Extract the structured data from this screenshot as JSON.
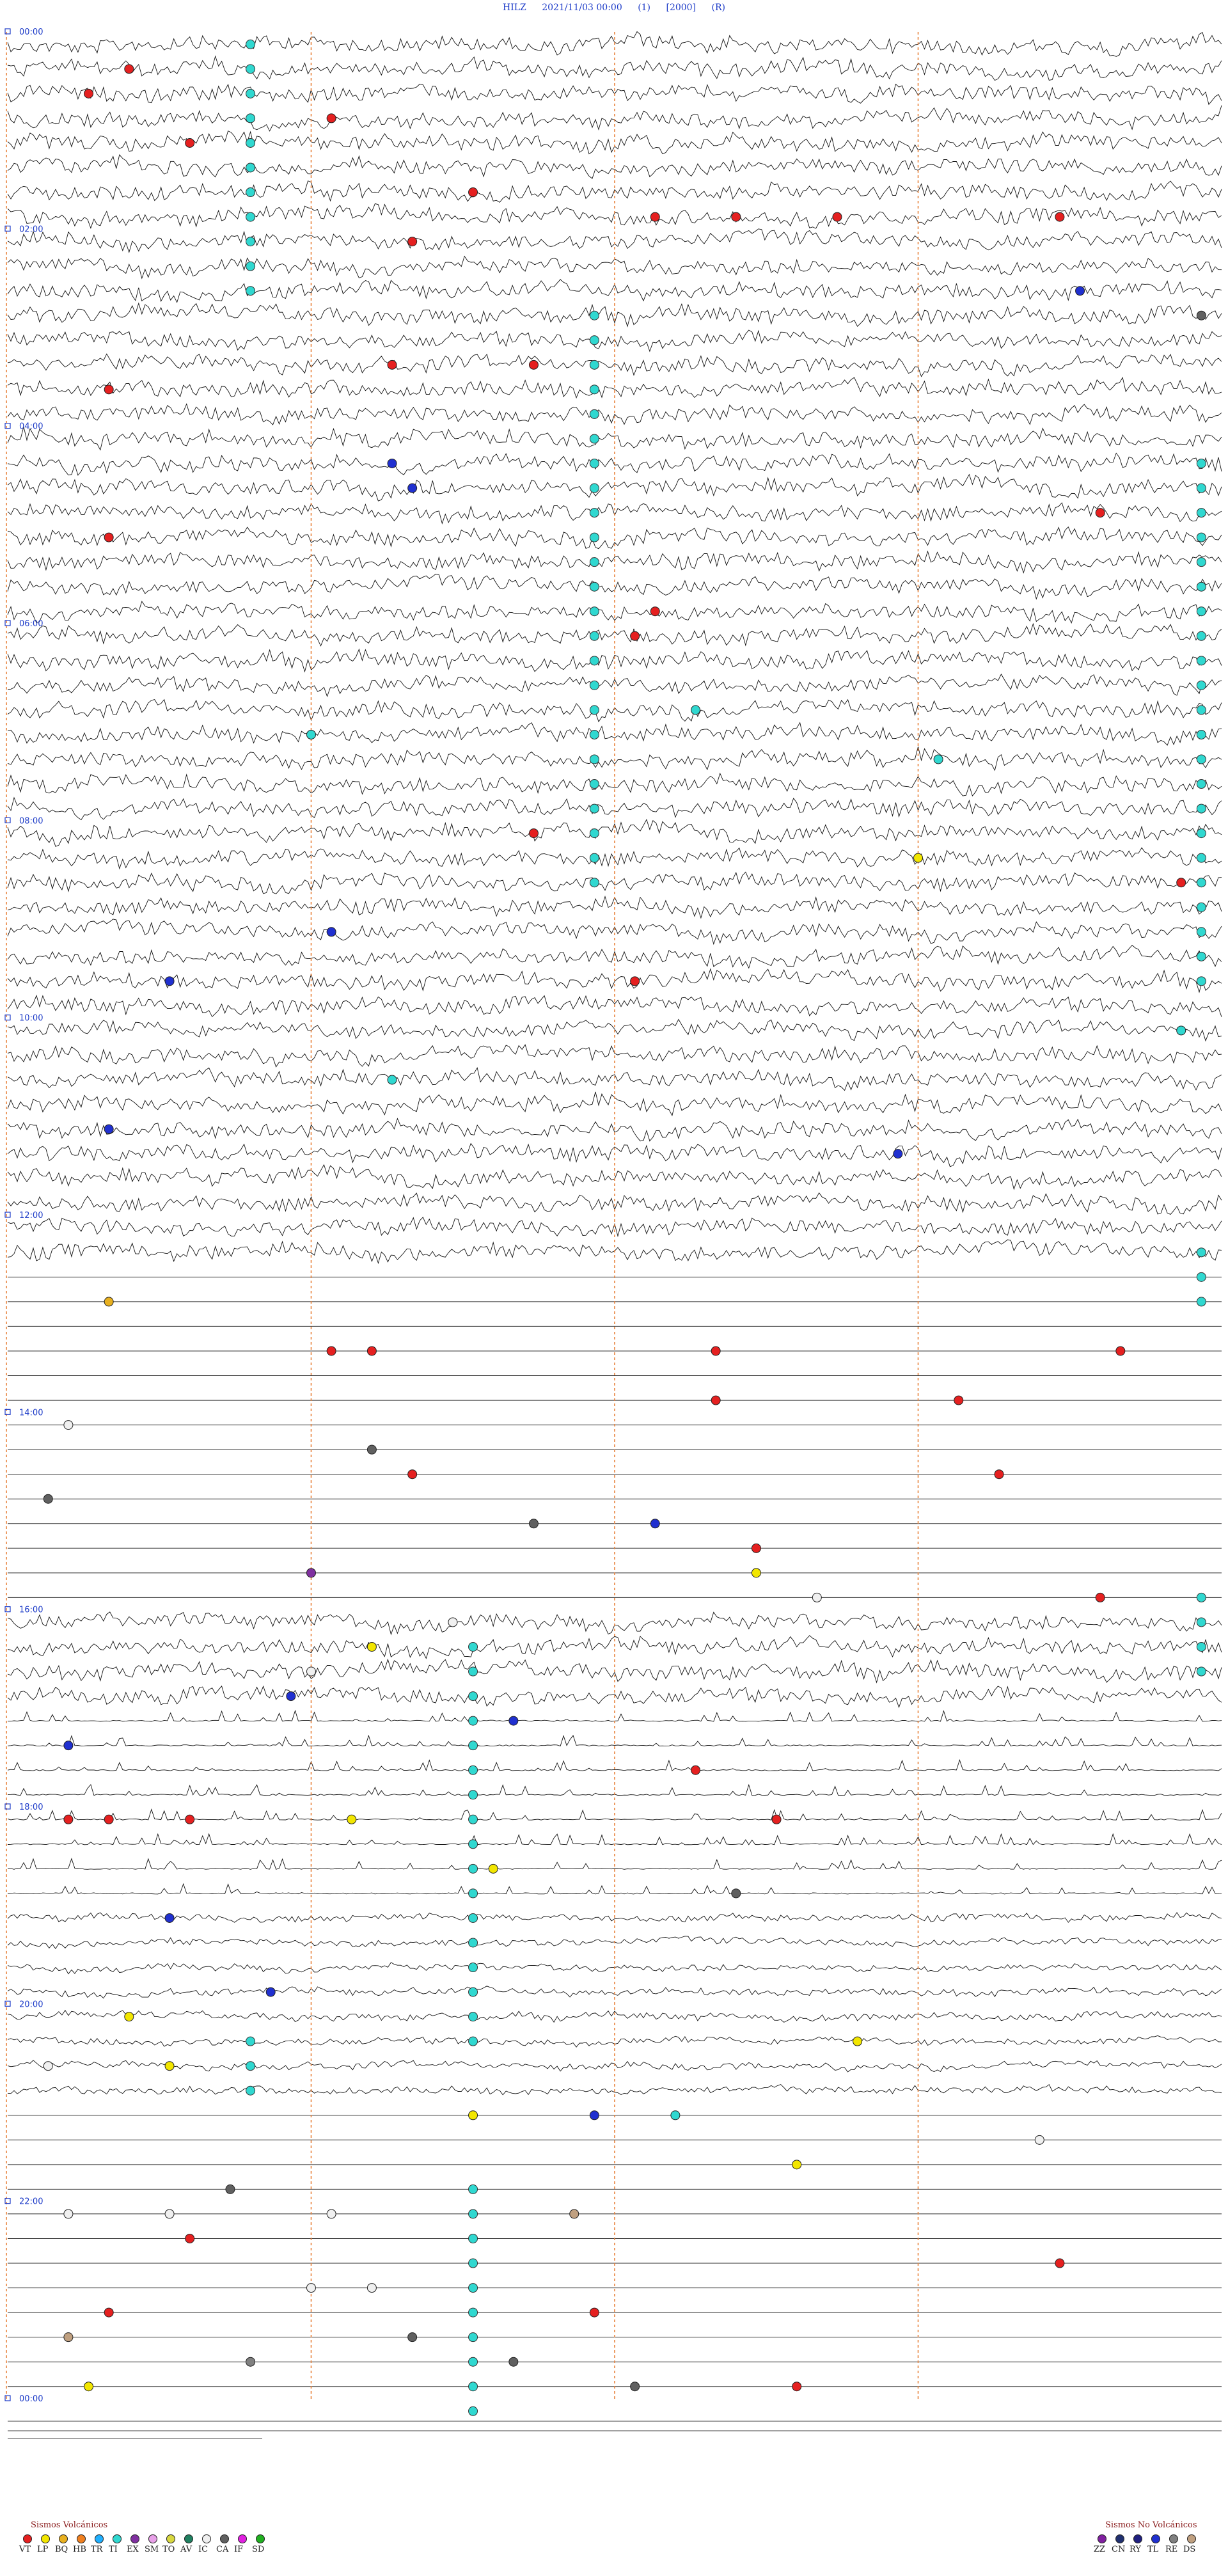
{
  "header": {
    "station": "HILZ",
    "datetime": "2021/11/03 00:00",
    "flag1": "(1)",
    "scale": "[2000]",
    "flag2": "(R)"
  },
  "chart_data": {
    "type": "helicorder",
    "title": "HILZ  2021/11/03 00:00  (1)  [2000]  (R)",
    "hour_labels": [
      {
        "hour": 0,
        "label": "00:00"
      },
      {
        "hour": 2,
        "label": "02:00"
      },
      {
        "hour": 4,
        "label": "04:00"
      },
      {
        "hour": 6,
        "label": "06:00"
      },
      {
        "hour": 8,
        "label": "08:00"
      },
      {
        "hour": 10,
        "label": "10:00"
      },
      {
        "hour": 12,
        "label": "12:00"
      },
      {
        "hour": 14,
        "label": "14:00"
      },
      {
        "hour": 16,
        "label": "16:00"
      },
      {
        "hour": 18,
        "label": "18:00"
      },
      {
        "hour": 20,
        "label": "20:00"
      },
      {
        "hour": 22,
        "label": "22:00"
      },
      {
        "hour": 24,
        "label": "00:00"
      }
    ],
    "minute_markers": [
      15,
      30,
      45
    ],
    "trace_minutes": 15,
    "total_hours": 24,
    "segments": [
      {
        "from_hour": 0,
        "to_hour": 12.5,
        "amplitude": "high"
      },
      {
        "from_hour": 12.5,
        "to_hour": 16,
        "amplitude": "flat"
      },
      {
        "from_hour": 16,
        "to_hour": 17,
        "amplitude": "high"
      },
      {
        "from_hour": 17,
        "to_hour": 19,
        "amplitude": "spiky"
      },
      {
        "from_hour": 19,
        "to_hour": 21,
        "amplitude": "medium"
      },
      {
        "from_hour": 21,
        "to_hour": 24,
        "amplitude": "flat"
      }
    ],
    "events": [
      {
        "hour": 0.25,
        "minute": 6,
        "type": "VT"
      },
      {
        "hour": 0.5,
        "minute": 4,
        "type": "VT"
      },
      {
        "hour": 0.75,
        "minute": 16,
        "type": "VT"
      },
      {
        "hour": 1.0,
        "minute": 9,
        "type": "VT"
      },
      {
        "hour": 1.5,
        "minute": 23,
        "type": "VT"
      },
      {
        "hour": 1.75,
        "minute": 32,
        "type": "VT"
      },
      {
        "hour": 1.75,
        "minute": 36,
        "type": "VT"
      },
      {
        "hour": 1.75,
        "minute": 41,
        "type": "VT"
      },
      {
        "hour": 1.75,
        "minute": 52,
        "type": "VT"
      },
      {
        "hour": 2.0,
        "minute": 20,
        "type": "VT"
      },
      {
        "hour": 2.5,
        "minute": 53,
        "type": "TL"
      },
      {
        "hour": 2.75,
        "minute": 59,
        "type": "CA"
      },
      {
        "hour": 3.25,
        "minute": 19,
        "type": "VT"
      },
      {
        "hour": 3.25,
        "minute": 26,
        "type": "VT"
      },
      {
        "hour": 3.5,
        "minute": 5,
        "type": "VT"
      },
      {
        "hour": 4.25,
        "minute": 19,
        "type": "TL"
      },
      {
        "hour": 4.5,
        "minute": 20,
        "type": "TL"
      },
      {
        "hour": 4.75,
        "minute": 54,
        "type": "VT"
      },
      {
        "hour": 5.0,
        "minute": 5,
        "type": "VT"
      },
      {
        "hour": 5.75,
        "minute": 32,
        "type": "VT"
      },
      {
        "hour": 6.0,
        "minute": 31,
        "type": "VT"
      },
      {
        "hour": 6.75,
        "minute": 34,
        "type": "TI"
      },
      {
        "hour": 7.0,
        "minute": 15,
        "type": "TI"
      },
      {
        "hour": 7.25,
        "minute": 46,
        "type": "TI"
      },
      {
        "hour": 8.0,
        "minute": 26,
        "type": "VT"
      },
      {
        "hour": 8.25,
        "minute": 45,
        "type": "LP"
      },
      {
        "hour": 8.5,
        "minute": 58,
        "type": "VT"
      },
      {
        "hour": 9.0,
        "minute": 16,
        "type": "TL"
      },
      {
        "hour": 9.5,
        "minute": 8,
        "type": "TL"
      },
      {
        "hour": 9.5,
        "minute": 31,
        "type": "VT"
      },
      {
        "hour": 10.0,
        "minute": 58,
        "type": "TI"
      },
      {
        "hour": 10.5,
        "minute": 19,
        "type": "TI"
      },
      {
        "hour": 11.0,
        "minute": 5,
        "type": "TL"
      },
      {
        "hour": 11.25,
        "minute": 44,
        "type": "TL"
      },
      {
        "hour": 12.75,
        "minute": 5,
        "type": "BQ"
      },
      {
        "hour": 13.25,
        "minute": 16,
        "type": "VT"
      },
      {
        "hour": 13.25,
        "minute": 18,
        "type": "VT"
      },
      {
        "hour": 13.25,
        "minute": 35,
        "type": "VT"
      },
      {
        "hour": 13.25,
        "minute": 55,
        "type": "VT"
      },
      {
        "hour": 13.75,
        "minute": 35,
        "type": "VT"
      },
      {
        "hour": 13.75,
        "minute": 47,
        "type": "VT"
      },
      {
        "hour": 14.0,
        "minute": 3,
        "type": "IC"
      },
      {
        "hour": 14.25,
        "minute": 18,
        "type": "CA"
      },
      {
        "hour": 14.5,
        "minute": 20,
        "type": "VT"
      },
      {
        "hour": 14.5,
        "minute": 49,
        "type": "VT"
      },
      {
        "hour": 14.75,
        "minute": 2,
        "type": "CA"
      },
      {
        "hour": 15.0,
        "minute": 26,
        "type": "CA"
      },
      {
        "hour": 15.0,
        "minute": 32,
        "type": "TL"
      },
      {
        "hour": 15.25,
        "minute": 37,
        "type": "VT"
      },
      {
        "hour": 15.5,
        "minute": 15,
        "type": "EX"
      },
      {
        "hour": 15.5,
        "minute": 37,
        "type": "LP"
      },
      {
        "hour": 15.75,
        "minute": 40,
        "type": "IC"
      },
      {
        "hour": 15.75,
        "minute": 54,
        "type": "VT"
      },
      {
        "hour": 16.0,
        "minute": 22,
        "type": "IC"
      },
      {
        "hour": 16.25,
        "minute": 18,
        "type": "LP"
      },
      {
        "hour": 16.5,
        "minute": 15,
        "type": "IC"
      },
      {
        "hour": 16.75,
        "minute": 14,
        "type": "TL"
      },
      {
        "hour": 17.0,
        "minute": 25,
        "type": "TL"
      },
      {
        "hour": 17.25,
        "minute": 3,
        "type": "TL"
      },
      {
        "hour": 17.5,
        "minute": 34,
        "type": "VT"
      },
      {
        "hour": 18.0,
        "minute": 3,
        "type": "VT"
      },
      {
        "hour": 18.0,
        "minute": 5,
        "type": "VT"
      },
      {
        "hour": 18.0,
        "minute": 9,
        "type": "VT"
      },
      {
        "hour": 18.0,
        "minute": 17,
        "type": "LP"
      },
      {
        "hour": 18.0,
        "minute": 38,
        "type": "VT"
      },
      {
        "hour": 18.5,
        "minute": 24,
        "type": "LP"
      },
      {
        "hour": 18.75,
        "minute": 36,
        "type": "CA"
      },
      {
        "hour": 19.0,
        "minute": 8,
        "type": "TL"
      },
      {
        "hour": 19.75,
        "minute": 13,
        "type": "TL"
      },
      {
        "hour": 20.0,
        "minute": 6,
        "type": "LP"
      },
      {
        "hour": 20.25,
        "minute": 42,
        "type": "LP"
      },
      {
        "hour": 20.5,
        "minute": 2,
        "type": "IC"
      },
      {
        "hour": 20.5,
        "minute": 8,
        "type": "LP"
      },
      {
        "hour": 21.0,
        "minute": 23,
        "type": "LP"
      },
      {
        "hour": 21.0,
        "minute": 29,
        "type": "TL"
      },
      {
        "hour": 21.0,
        "minute": 33,
        "type": "TI"
      },
      {
        "hour": 21.25,
        "minute": 51,
        "type": "IC"
      },
      {
        "hour": 21.5,
        "minute": 39,
        "type": "LP"
      },
      {
        "hour": 21.75,
        "minute": 11,
        "type": "CA"
      },
      {
        "hour": 22.0,
        "minute": 3,
        "type": "IC"
      },
      {
        "hour": 22.0,
        "minute": 8,
        "type": "IC"
      },
      {
        "hour": 22.0,
        "minute": 16,
        "type": "IC"
      },
      {
        "hour": 22.0,
        "minute": 28,
        "type": "DS"
      },
      {
        "hour": 22.25,
        "minute": 9,
        "type": "VT"
      },
      {
        "hour": 22.5,
        "minute": 52,
        "type": "VT"
      },
      {
        "hour": 22.75,
        "minute": 15,
        "type": "IC"
      },
      {
        "hour": 22.75,
        "minute": 18,
        "type": "IC"
      },
      {
        "hour": 23.0,
        "minute": 5,
        "type": "VT"
      },
      {
        "hour": 23.0,
        "minute": 29,
        "type": "VT"
      },
      {
        "hour": 23.25,
        "minute": 3,
        "type": "DS"
      },
      {
        "hour": 23.25,
        "minute": 20,
        "type": "CA"
      },
      {
        "hour": 23.5,
        "minute": 12,
        "type": "RE"
      },
      {
        "hour": 23.5,
        "minute": 25,
        "type": "CA"
      },
      {
        "hour": 23.75,
        "minute": 4,
        "type": "LP"
      },
      {
        "hour": 23.75,
        "minute": 39,
        "type": "VT"
      },
      {
        "hour": 23.75,
        "minute": 31,
        "type": "CA"
      }
    ],
    "tremor_bands": [
      {
        "minute": 12,
        "from_hour": 0,
        "to_hour": 2.5
      },
      {
        "minute": 29,
        "from_hour": 2.75,
        "to_hour": 8.5
      },
      {
        "minute": 59,
        "from_hour": 4.25,
        "to_hour": 9.5
      },
      {
        "minute": 59,
        "from_hour": 12.25,
        "to_hour": 12.75
      },
      {
        "minute": 59,
        "from_hour": 15.75,
        "to_hour": 16.5
      },
      {
        "minute": 23,
        "from_hour": 16.25,
        "to_hour": 20.25
      },
      {
        "minute": 12,
        "from_hour": 20.25,
        "to_hour": 20.75
      },
      {
        "minute": 23,
        "from_hour": 21.75,
        "to_hour": 24
      }
    ],
    "legend_left": {
      "title": "Sismos Volcánicos",
      "items": [
        {
          "code": "VT",
          "color": "#e52020"
        },
        {
          "code": "LP",
          "color": "#f2e600"
        },
        {
          "code": "BQ",
          "color": "#e8b020"
        },
        {
          "code": "HB",
          "color": "#f08020"
        },
        {
          "code": "TR",
          "color": "#20b0ff"
        },
        {
          "code": "TI",
          "color": "#30d8d0"
        },
        {
          "code": "EX",
          "color": "#8030a0"
        },
        {
          "code": "SM",
          "color": "#e8a0e8"
        },
        {
          "code": "TO",
          "color": "#d8d840"
        },
        {
          "code": "AV",
          "color": "#208060"
        },
        {
          "code": "IC",
          "color": "#f0f0f0"
        },
        {
          "code": "CA",
          "color": "#606060"
        },
        {
          "code": "IF",
          "color": "#e020e0"
        },
        {
          "code": "SD",
          "color": "#20b020"
        }
      ]
    },
    "legend_right": {
      "title": "Sismos No Volcánicos",
      "items": [
        {
          "code": "ZZ",
          "color": "#8020a0"
        },
        {
          "code": "CN",
          "color": "#203070"
        },
        {
          "code": "RY",
          "color": "#202080"
        },
        {
          "code": "TL",
          "color": "#2030d0"
        },
        {
          "code": "RE",
          "color": "#808080"
        },
        {
          "code": "DS",
          "color": "#c0a080"
        }
      ]
    }
  }
}
